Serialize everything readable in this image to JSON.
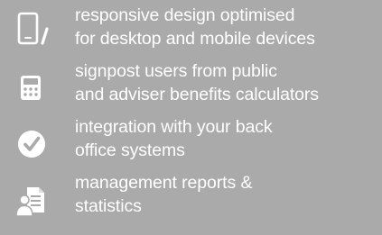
{
  "features": [
    {
      "icon": "mobile-tablet-icon",
      "lines": [
        "responsive design optimised",
        "for desktop and mobile devices"
      ]
    },
    {
      "icon": "calculator-icon",
      "lines": [
        "signpost users from public",
        "and adviser benefits calculators"
      ]
    },
    {
      "icon": "check-circle-icon",
      "lines": [
        "integration with your back",
        "office systems"
      ]
    },
    {
      "icon": "report-user-icon",
      "lines": [
        "management reports &",
        "statistics"
      ]
    }
  ],
  "colors": {
    "background": "#aaaaaa",
    "foreground": "#ffffff"
  }
}
